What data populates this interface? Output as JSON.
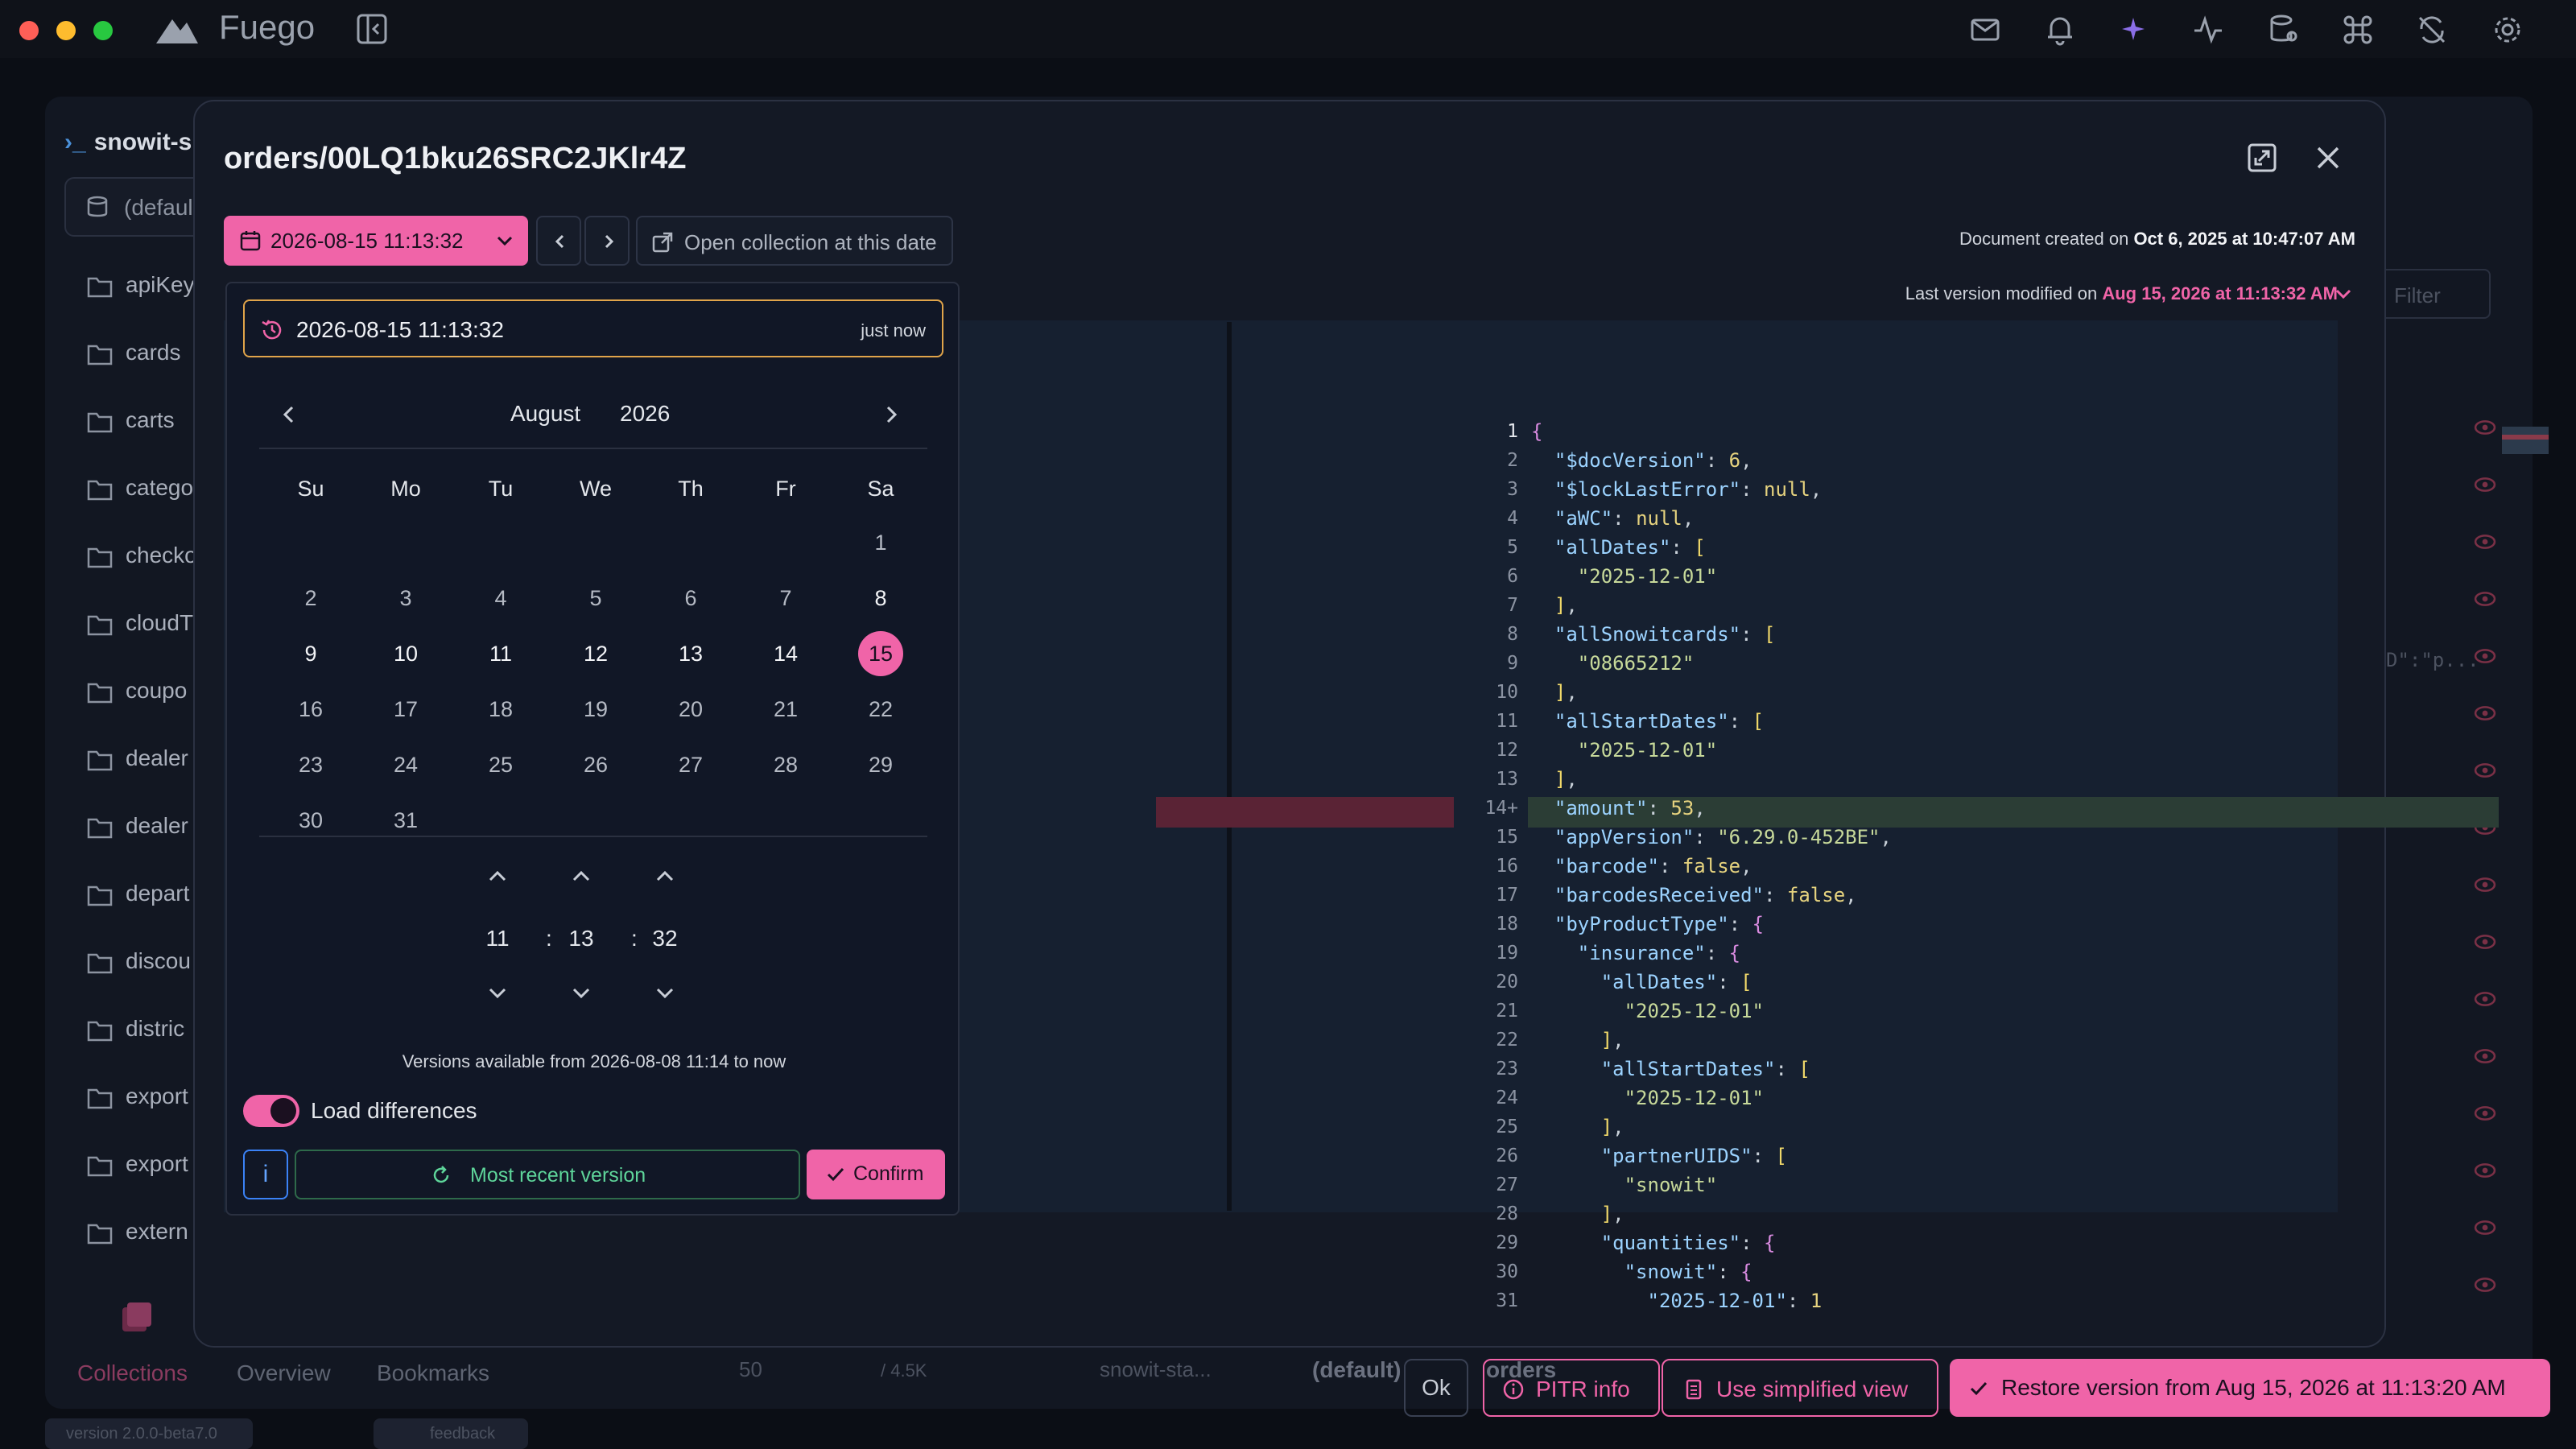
{
  "window": {
    "app_name": "Fuego",
    "traffic_colors": [
      "#fe5f57",
      "#febc2e",
      "#28c840"
    ]
  },
  "toolbar_icons": [
    "mail-check-icon",
    "bell-icon",
    "sparkles-icon",
    "activity-icon",
    "database-search-icon",
    "command-icon",
    "sync-off-icon",
    "gear-icon"
  ],
  "background": {
    "project_title": "snowit-s",
    "database_label": "(defaul",
    "collections": [
      "apiKey",
      "cards",
      "carts",
      "catego",
      "checko",
      "cloudT",
      "coupo",
      "dealer",
      "dealer",
      "depart",
      "discou",
      "distric",
      "export",
      "export",
      "extern"
    ],
    "tabs": [
      "Collections",
      "Overview",
      "Bookmarks"
    ],
    "filter_label": "Filter",
    "page_size": "50",
    "total": "/ 4.5K",
    "breadcrumb": [
      "snowit-sta...",
      "(default)",
      "orders"
    ],
    "version": "version 2.0.0-beta7.0",
    "feedback": "feedback",
    "preview_snippet": "D\":\"p..."
  },
  "modal": {
    "title": "orders/00LQ1bku26SRC2JKlr4Z",
    "selected_datetime": "2026-08-15 11:13:32",
    "open_collection_label": "Open collection at this date",
    "doc_created_prefix": "Document created on",
    "doc_created_date": "Oct 6, 2025 at 10:47:07 AM",
    "last_modified_prefix": "Last version modified on",
    "last_modified_date": "Aug 15, 2026 at 11:13:32 AM",
    "footer": {
      "ok": "Ok",
      "pitr": "PITR info",
      "simplified": "Use simplified view",
      "restore": "Restore version from Aug 15, 2026 at 11:13:20 AM"
    }
  },
  "picker": {
    "input_value": "2026-08-15 11:13:32",
    "relative": "just now",
    "month": "August",
    "year": "2026",
    "weekdays": [
      "Su",
      "Mo",
      "Tu",
      "We",
      "Th",
      "Fr",
      "Sa"
    ],
    "first_weekday_index": 6,
    "days_in_month": 31,
    "selected_day": 15,
    "available_from_day": 8,
    "available_to_day": 15,
    "hours": "11",
    "minutes": "13",
    "seconds": "32",
    "versions_available": "Versions available from 2026-08-08 11:14 to now",
    "load_differences_label": "Load differences",
    "load_differences_on": true,
    "info_label": "i",
    "most_recent_label": "Most recent version",
    "confirm_label": "Confirm"
  },
  "editor": {
    "highlight_line": 14,
    "lines": [
      "{",
      "  \"$docVersion\": 6,",
      "  \"$lockLastError\": null,",
      "  \"aWC\": null,",
      "  \"allDates\": [",
      "    \"2025-12-01\"",
      "  ],",
      "  \"allSnowitcards\": [",
      "    \"08665212\"",
      "  ],",
      "  \"allStartDates\": [",
      "    \"2025-12-01\"",
      "  ],",
      "  \"amount\": 53,",
      "  \"appVersion\": \"6.29.0-452BE\",",
      "  \"barcode\": false,",
      "  \"barcodesReceived\": false,",
      "  \"byProductType\": {",
      "    \"insurance\": {",
      "      \"allDates\": [",
      "        \"2025-12-01\"",
      "      ],",
      "      \"allStartDates\": [",
      "        \"2025-12-01\"",
      "      ],",
      "      \"partnerUIDS\": [",
      "        \"snowit\"",
      "      ],",
      "      \"quantities\": {",
      "        \"snowit\": {",
      "          \"2025-12-01\": 1"
    ]
  },
  "colors": {
    "accent": "#f064a8",
    "warning_border": "#e0a44a",
    "success": "#5ed59a",
    "info": "#3b82f6"
  }
}
